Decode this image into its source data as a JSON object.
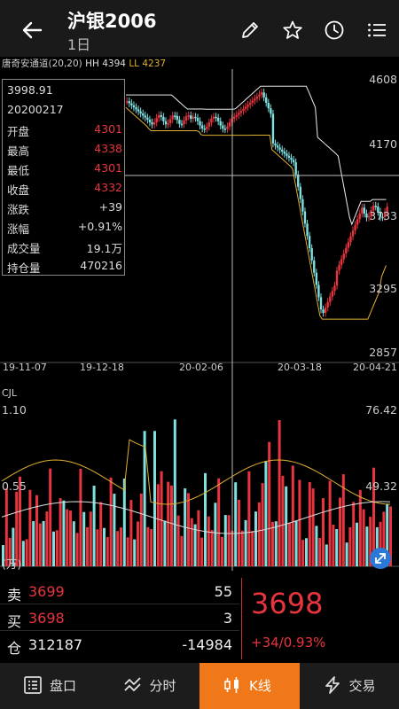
{
  "header": {
    "title": "沪银2006",
    "subtitle": "1日"
  },
  "indicator": {
    "name": "唐奇安通道(20,20)",
    "hh": "HH 4394",
    "ll": "LL 4237"
  },
  "price_axis": [
    "4608",
    "4170",
    "3733",
    "3295",
    "2857"
  ],
  "date_axis": [
    "19-11-07",
    "19-12-18",
    "20-02-06",
    "20-03-18",
    "20-04-21"
  ],
  "info_panel": {
    "crosshair_price": "3998.91",
    "date": "20200217",
    "rows": [
      {
        "label": "开盘",
        "value": "4301",
        "red": true
      },
      {
        "label": "最高",
        "value": "4338",
        "red": true
      },
      {
        "label": "最低",
        "value": "4301",
        "red": true
      },
      {
        "label": "收盘",
        "value": "4332",
        "red": true
      },
      {
        "label": "涨跌",
        "value": "+39",
        "red": false
      },
      {
        "label": "涨幅",
        "value": "+0.91%",
        "red": false
      },
      {
        "label": "成交量",
        "value": "19.1万",
        "red": false
      },
      {
        "label": "持仓量",
        "value": "470216",
        "red": false
      }
    ]
  },
  "volume": {
    "label": "CJL",
    "left_top": "1.10",
    "left_mid": "0.55",
    "left_bottom": "(万)",
    "right_top": "76.42",
    "right_mid": "49.32"
  },
  "quote": {
    "sell_label": "卖",
    "sell_price": "3699",
    "sell_qty": "55",
    "buy_label": "买",
    "buy_price": "3698",
    "buy_qty": "3",
    "oi_label": "仓",
    "oi_value": "312187",
    "oi_change": "-14984",
    "last_price": "3698",
    "change": "+34/0.93%"
  },
  "nav": [
    {
      "label": "盘口",
      "icon": "grid-icon",
      "active": false
    },
    {
      "label": "分时",
      "icon": "wave-icon",
      "active": false
    },
    {
      "label": "K线",
      "icon": "candle-icon",
      "active": true
    },
    {
      "label": "交易",
      "icon": "lightning-icon",
      "active": false
    }
  ],
  "colors": {
    "up": "#e8343e",
    "down": "#7fe0e0",
    "accent": "#f07818",
    "ll_line": "#e0b030"
  }
}
